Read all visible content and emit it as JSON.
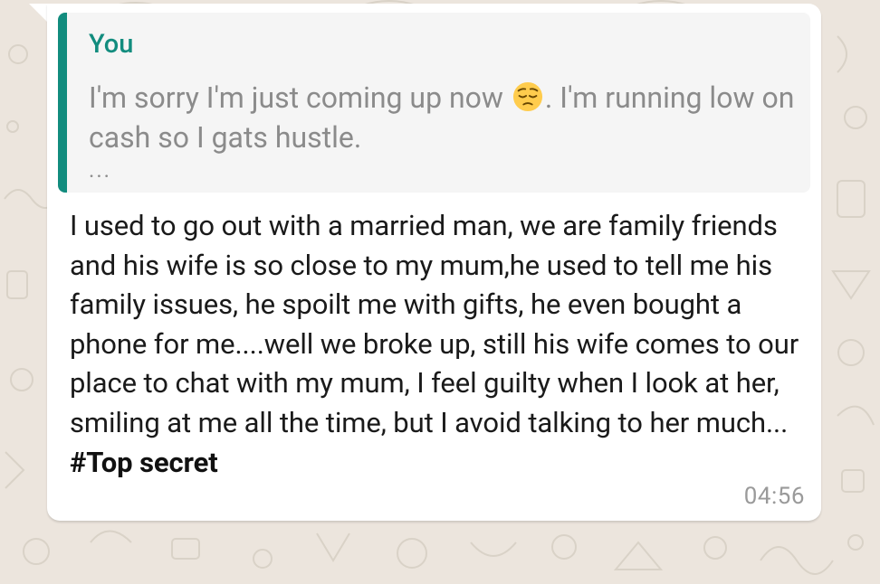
{
  "chat": {
    "background_color": "#ece5dd",
    "bubble_color": "#ffffff",
    "quoted_message": {
      "author": "You",
      "author_color": "#128c7e",
      "text_before_emoji": "I'm sorry I'm just coming up now",
      "emoji": "pensive-face-emoji",
      "text_after_emoji": ". I'm running low on cash so I gats hustle.",
      "more_indicator": "..."
    },
    "message": {
      "text": "I used to go out with a married man, we are family friends and his wife is so close to my mum,he used to tell me his family issues, he spoilt me with gifts, he even bought a phone for me....well we broke up, still his wife comes to our place to chat with my mum, I feel guilty when I look at her, smiling at me all the time, but I avoid talking to her much...",
      "hashtag": "#Top secret"
    },
    "timestamp": "04:56"
  }
}
